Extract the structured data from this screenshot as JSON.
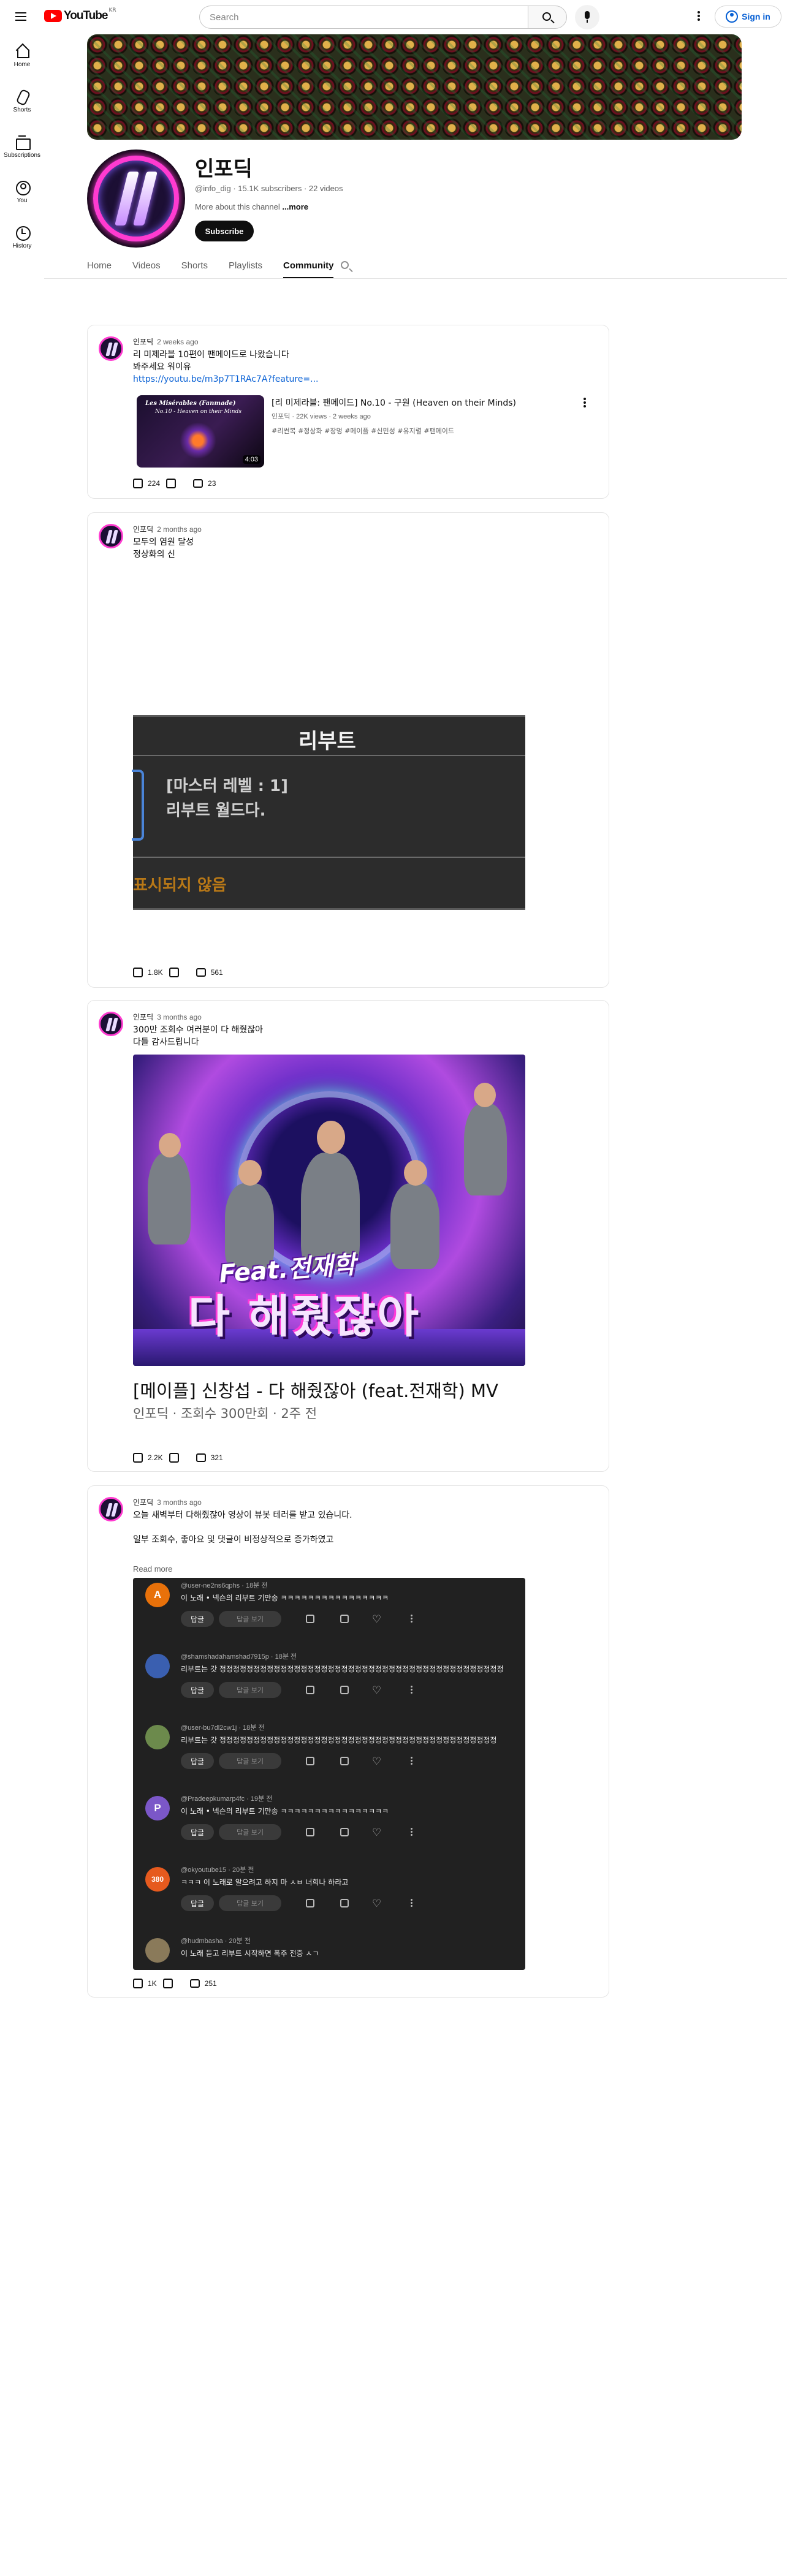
{
  "header": {
    "logo_text": "YouTube",
    "region": "KR",
    "search_placeholder": "Search",
    "sign_in": "Sign in"
  },
  "rail": [
    {
      "label": "Home",
      "icon": "home-icon"
    },
    {
      "label": "Shorts",
      "icon": "shorts-icon"
    },
    {
      "label": "Subscriptions",
      "icon": "subscriptions-icon"
    },
    {
      "label": "You",
      "icon": "you-icon"
    },
    {
      "label": "History",
      "icon": "history-icon"
    }
  ],
  "channel": {
    "name": "인포딕",
    "meta": "@info_dig · 15.1K subscribers · 22 videos",
    "about": "More about this channel",
    "about_more": "...more",
    "subscribe": "Subscribe",
    "tabs": [
      "Home",
      "Videos",
      "Shorts",
      "Playlists",
      "Community"
    ],
    "active_tab": "Community"
  },
  "posts": [
    {
      "author": "인포딕",
      "time": "2 weeks ago",
      "lines": [
        "리 미제라블 10편이 팬메이드로 나왔습니다",
        "봐주세요 워이유"
      ],
      "link": "https://youtu.be/m3p7T1RAc7A?feature=...",
      "video": {
        "thumb_title": "Les Misérables (Fanmade)",
        "thumb_sub": "No.10 - Heaven on their Minds",
        "duration": "4:03",
        "title": "[리 미제라블: 팬메이드] No.10 - 구원 (Heaven on their Minds)",
        "meta": "인포딕 · 22K views · 2 weeks ago",
        "tags": "#리썬복 #정상화 #장멍 #메이플 #신민성 #유지렬 #팬메이드"
      },
      "likes": "224",
      "comments": "23"
    },
    {
      "author": "인포딕",
      "time": "2 months ago",
      "lines": [
        "모두의 염원 달성",
        "정상화의 신"
      ],
      "image": {
        "title": "리부트",
        "line1": "[마스터 레벨 : 1]",
        "line2": "리부트 월드다.",
        "bottom": "표시되지 않음"
      },
      "likes": "1.8K",
      "comments": "561"
    },
    {
      "author": "인포딕",
      "time": "3 months ago",
      "lines": [
        "300만 조회수 여러분이 다 해줬잖아",
        "다들 감사드립니다"
      ],
      "image": {
        "feat": "Feat.전재학",
        "title": "다 해줬잖아"
      },
      "caption": "[메이플] 신창섭 - 다 해줬잖아 (feat.전재학) MV",
      "caption_sub": "인포딕 · 조회수 300만회 · 2주 전",
      "likes": "2.2K",
      "comments": "321"
    },
    {
      "author": "인포딕",
      "time": "3 months ago",
      "lines": [
        "오늘 새벽부터 다해줬잖아 영상이 뷰봇 테러를 받고 있습니다.",
        "",
        "일부 조회수, 좋아요 및 댓글이 비정상적으로 증가하였고"
      ],
      "read_more": "Read more",
      "comments_shot": [
        {
          "avatar": "A",
          "color": "#e8710a",
          "user": "@user-ne2ns6qphs · 18분 전",
          "text": "이 노래 • 넥슨의 리부트 기만송 ㅋㅋㅋㅋㅋㅋㅋㅋㅋㅋㅋㅋㅋㅋㅋㅋ",
          "reply": "답글",
          "replies": "답글 보기"
        },
        {
          "avatar": "",
          "color": "#3a5fb0",
          "user": "@shamshadahamshad7915p · 18분 전",
          "text": "리부트는 갓 정정정정정정정정정정정정정정정정정정정정정정정정정정정정정정정정정정정정정정정정정정",
          "reply": "답글",
          "replies": "답글 보기"
        },
        {
          "avatar": "",
          "color": "#6c8a4c",
          "user": "@user-bu7dl2cw1j · 18분 전",
          "text": "리부트는 갓 정정정정정정정정정정정정정정정정정정정정정정정정정정정정정정정정정정정정정정정정정",
          "reply": "답글",
          "replies": "답글 보기"
        },
        {
          "avatar": "P",
          "color": "#7b57c8",
          "user": "@Pradeepkumarp4fc · 19분 전",
          "text": "이 노래 • 넥슨의 리부트 기만송 ㅋㅋㅋㅋㅋㅋㅋㅋㅋㅋㅋㅋㅋㅋㅋㅋ",
          "reply": "답글",
          "replies": "답글 보기"
        },
        {
          "avatar": "380",
          "color": "#e65a1e",
          "user": "@okyoutube15 · 20분 전",
          "text": "ㅋㅋㅋ 이 노래로 알으려고 하지 마 ㅅㅂ 너희나 하라고",
          "reply": "답글",
          "replies": "답글 보기"
        },
        {
          "avatar": "",
          "color": "#8a7a5a",
          "user": "@hudmbasha · 20분 전",
          "text": "이 노래 듣고 리부트 시작하면 폭주 전증 ㅅㄱ",
          "reply": "",
          "replies": ""
        }
      ],
      "likes": "1K",
      "comments": "251"
    }
  ]
}
